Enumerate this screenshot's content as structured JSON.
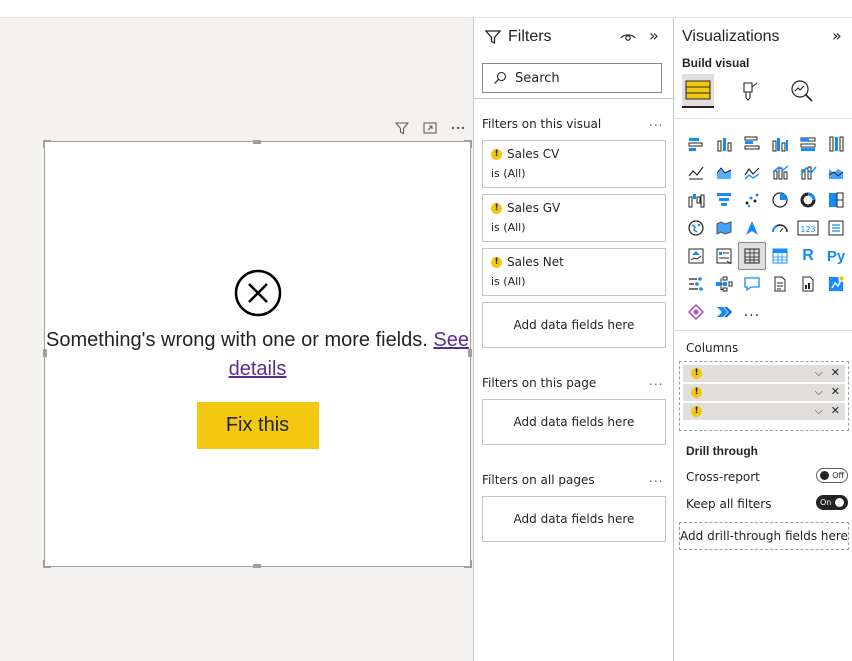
{
  "canvas": {
    "error_message": "Something's wrong with one or more fields.",
    "see_details_link": "See details",
    "fix_button": "Fix this"
  },
  "filters_pane": {
    "title": "Filters",
    "search_placeholder": "Search",
    "sections": {
      "on_visual": "Filters on this visual",
      "on_page": "Filters on this page",
      "on_all_pages": "Filters on all pages"
    },
    "visual_filters": [
      {
        "name": "Sales CV",
        "value": "is (All)"
      },
      {
        "name": "Sales GV",
        "value": "is (All)"
      },
      {
        "name": "Sales Net",
        "value": "is (All)"
      }
    ],
    "add_fields_label": "Add data fields here",
    "more_label": "...",
    "collapse_label": "»"
  },
  "viz_pane": {
    "title": "Visualizations",
    "build_visual": "Build visual",
    "columns_label": "Columns",
    "drill_through": "Drill through",
    "cross_report": "Cross-report",
    "cross_report_state": "Off",
    "keep_all_filters": "Keep all filters",
    "keep_all_filters_state": "On",
    "add_drill_fields": "Add drill-through fields here",
    "more_visuals": "...",
    "r_label": "R",
    "py_label": "Py",
    "num_label": "123",
    "collapse_label": "»"
  },
  "colors": {
    "accent_yellow": "#f2c811",
    "link_purple": "#5c2d91",
    "chart_blue": "#118dff",
    "dark_text": "#252423"
  }
}
